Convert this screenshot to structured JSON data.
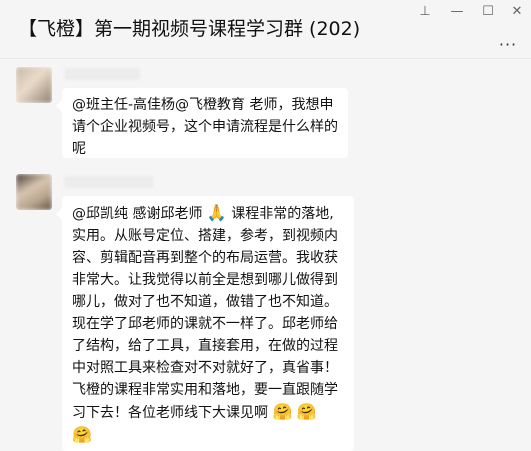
{
  "window": {
    "title": "【飞橙】第一期视频号课程学习群 (202)",
    "controls": {
      "pin": "⊥",
      "minimize": "—",
      "maximize": "☐",
      "close": "✕"
    },
    "more": "···"
  },
  "messages": [
    {
      "lines": [
        "@班主任-高佳杨@飞橙教育 老师，我想申",
        "请个企业视频号，这个申请流程是什么样的",
        "呢"
      ]
    },
    {
      "lines": [
        "@邱凯纯 感谢邱老师",
        "课程非常的落地,",
        "实用。从账号定位、搭建，参考，到视频内",
        "容、剪辑配音再到整个的布局运营。我收获",
        "非常大。让我觉得以前全是想到哪儿做得到",
        "哪儿，做对了也不知道，做错了也不知道。",
        "现在学了邱老师的课就不一样了。邱老师给",
        "了结构，给了工具，直接套用，在做的过程",
        "中对照工具来检查对不对就好了，真省事！",
        "飞橙的课程非常实用和落地，要一直跟随学",
        "习下去！各位老师线下大课见啊"
      ],
      "emojis": {
        "pray": "🙏",
        "hug": "🤗"
      }
    }
  ]
}
